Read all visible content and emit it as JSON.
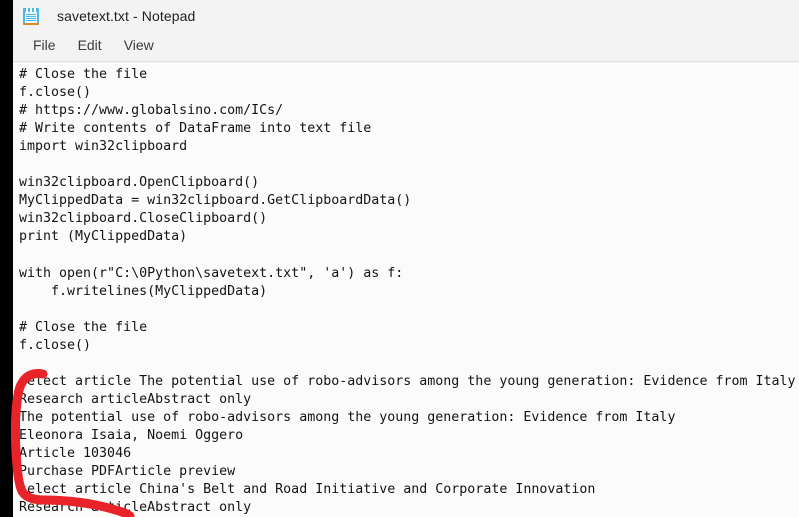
{
  "window": {
    "title": "savetext.txt - Notepad",
    "icon": "notepad-icon"
  },
  "menubar": {
    "items": [
      {
        "label": "File",
        "name": "menu-item-file"
      },
      {
        "label": "Edit",
        "name": "menu-item-edit"
      },
      {
        "label": "View",
        "name": "menu-item-view"
      }
    ]
  },
  "editor": {
    "content": "# Close the file\nf.close()\n# https://www.globalsino.com/ICs/\n# Write contents of DataFrame into text file\nimport win32clipboard\n\nwin32clipboard.OpenClipboard()\nMyClippedData = win32clipboard.GetClipboardData()\nwin32clipboard.CloseClipboard()\nprint (MyClippedData)\n\nwith open(r\"C:\\0Python\\savetext.txt\", 'a') as f:\n    f.writelines(MyClippedData)\n\n# Close the file\nf.close()\n\nselect article The potential use of robo-advisors among the young generation: Evidence from Italy\nResearch articleAbstract only\nThe potential use of robo-advisors among the young generation: Evidence from Italy\nEleonora Isaia, Noemi Oggero\nArticle 103046\nPurchase PDFArticle preview\nselect article China's Belt and Road Initiative and Corporate Innovation\nResearch articleAbstract only",
    "lines": [
      "# Close the file",
      "f.close()",
      "# https://www.globalsino.com/ICs/",
      "# Write contents of DataFrame into text file",
      "import win32clipboard",
      "",
      "win32clipboard.OpenClipboard()",
      "MyClippedData = win32clipboard.GetClipboardData()",
      "win32clipboard.CloseClipboard()",
      "print (MyClippedData)",
      "",
      "with open(r\"C:\\0Python\\savetext.txt\", 'a') as f:",
      "    f.writelines(MyClippedData)",
      "",
      "# Close the file",
      "f.close()",
      "",
      "select article The potential use of robo-advisors among the young generation: Evidence from Italy",
      "Research articleAbstract only",
      "The potential use of robo-advisors among the young generation: Evidence from Italy",
      "Eleonora Isaia, Noemi Oggero",
      "Article 103046",
      "Purchase PDFArticle preview",
      "select article China's Belt and Road Initiative and Corporate Innovation",
      "Research articleAbstract only"
    ]
  },
  "annotation": {
    "name": "red-bracket-annotation",
    "color": "#e8242a",
    "description": "hand-drawn red curved bracket marking the clipboard-pasted article block"
  },
  "colors": {
    "titlebar_bg": "#f3f3f3",
    "editor_bg": "#fbfbfb",
    "text": "#141414",
    "accent_icon": "#4cb8e8",
    "annotation_red": "#e8242a",
    "screen_edge": "#000000"
  }
}
